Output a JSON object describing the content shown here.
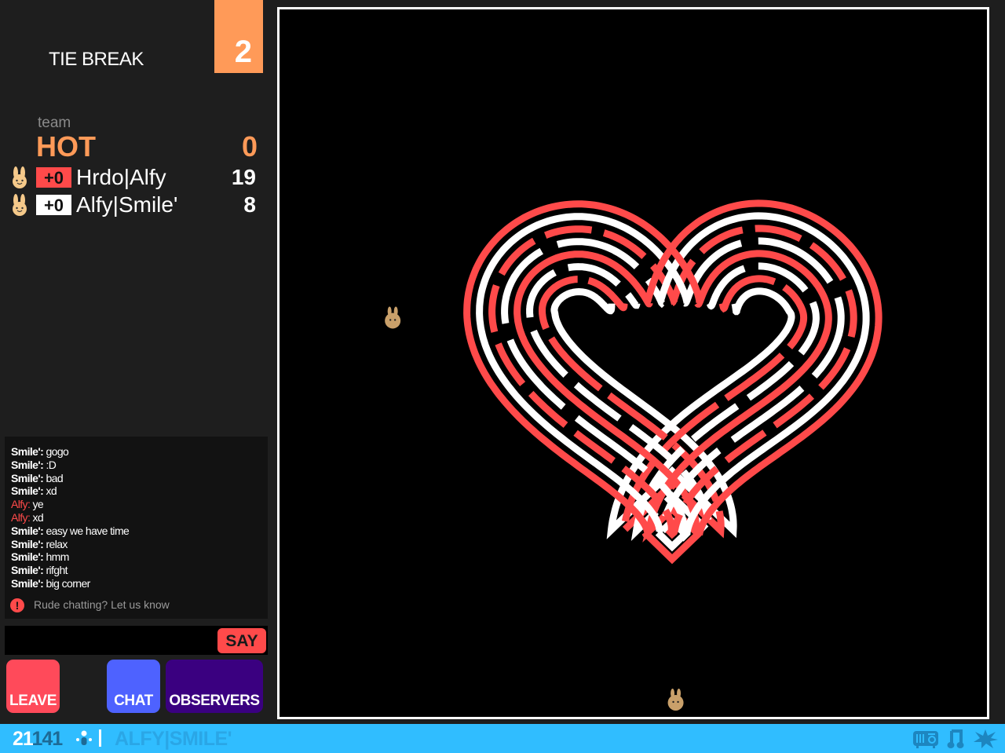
{
  "round": {
    "label": "TIE BREAK",
    "number": "2"
  },
  "team": {
    "caption": "team",
    "name": "HOT",
    "score": "0",
    "color": "#ff9a58",
    "players": [
      {
        "name": "Hrdo|Alfy",
        "delta": "+0",
        "score": "19",
        "delta_bg": "#ff4a4a",
        "avatar": "bunny-icon"
      },
      {
        "name": "Alfy|Smile'",
        "delta": "+0",
        "score": "8",
        "delta_bg": "#ffffff",
        "avatar": "bunny-icon"
      }
    ]
  },
  "chat": {
    "messages": [
      {
        "who": "Smile':",
        "text": "gogo",
        "color": "white"
      },
      {
        "who": "Smile':",
        "text": ":D",
        "color": "white"
      },
      {
        "who": "Smile':",
        "text": "bad",
        "color": "white"
      },
      {
        "who": "Smile':",
        "text": "xd",
        "color": "white"
      },
      {
        "who": "Alfy:",
        "text": "ye",
        "color": "red"
      },
      {
        "who": "Alfy:",
        "text": "xd",
        "color": "red"
      },
      {
        "who": "Smile':",
        "text": "easy we have time",
        "color": "white"
      },
      {
        "who": "Smile':",
        "text": "relax",
        "color": "white"
      },
      {
        "who": "Smile':",
        "text": "hmm",
        "color": "white"
      },
      {
        "who": "Smile':",
        "text": "rifght",
        "color": "white"
      },
      {
        "who": "Smile':",
        "text": "big corner",
        "color": "white"
      }
    ],
    "report_text": "Rude chatting? Let us know",
    "input_value": "",
    "input_placeholder": "",
    "say_label": "SAY"
  },
  "buttons": {
    "leave": "LEAVE",
    "chat": "CHAT",
    "observers": "OBSERVERS"
  },
  "status_bar": {
    "count_a": "21",
    "count_b": "141",
    "username": "ALFY|SMILE'",
    "icons": [
      "radio-icon",
      "music-note-icon",
      "explosion-icon"
    ]
  },
  "board": {
    "colors": {
      "red": "#ff4a4a",
      "white": "#ffffff",
      "background": "#000000"
    },
    "tracks": [
      {
        "color": "white",
        "dash": "none",
        "offset": 5
      },
      {
        "color": "red",
        "dash": "90 14",
        "offset": 4
      },
      {
        "color": "white",
        "dash": "70 18",
        "offset": 3
      },
      {
        "color": "red",
        "dash": "none",
        "offset": 2
      },
      {
        "color": "white",
        "dash": "110 22",
        "offset": 1
      },
      {
        "color": "red",
        "dash": "60 16",
        "offset": 0
      },
      {
        "color": "white",
        "dash": "none",
        "offset": -1
      },
      {
        "color": "red",
        "dash": "none",
        "offset": -2
      }
    ],
    "players": [
      {
        "name": "Hrdo|Alfy",
        "color": "red",
        "position_pct": [
          16,
          44
        ]
      },
      {
        "name": "Alfy|Smile'",
        "color": "white",
        "position_pct": [
          56,
          98
        ]
      }
    ]
  }
}
